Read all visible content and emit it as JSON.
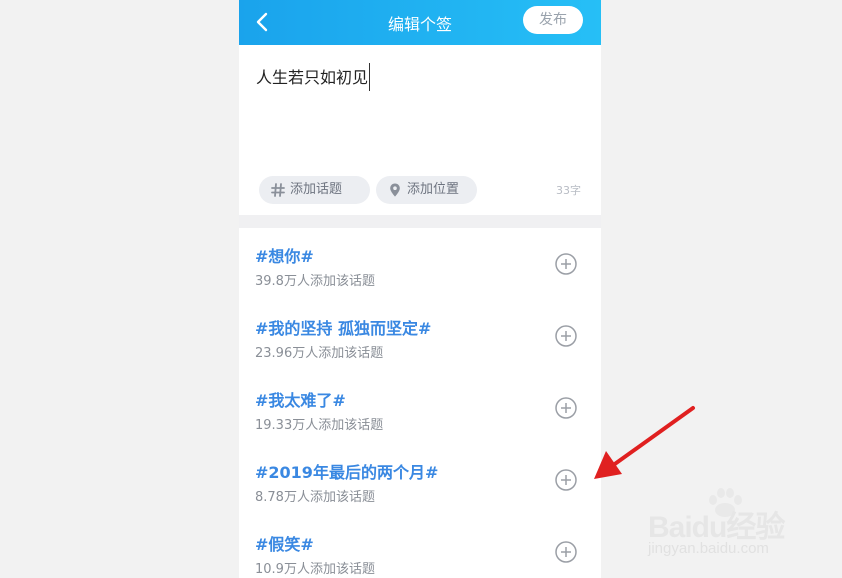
{
  "header": {
    "title": "编辑个签",
    "publish_label": "发布",
    "back_icon": "chevron-left-icon"
  },
  "editor": {
    "text": "人生若只如初见",
    "add_topic_label": "添加话题",
    "add_location_label": "添加位置",
    "char_count": "33字"
  },
  "topics": [
    {
      "title": "#想你#",
      "subtitle": "39.8万人添加该话题"
    },
    {
      "title": "#我的坚持 孤独而坚定#",
      "subtitle": "23.96万人添加该话题"
    },
    {
      "title": "#我太难了#",
      "subtitle": "19.33万人添加该话题"
    },
    {
      "title": "#2019年最后的两个月#",
      "subtitle": "8.78万人添加该话题"
    },
    {
      "title": "#假笑#",
      "subtitle": "10.9万人添加该话题"
    }
  ],
  "watermark": {
    "brand": "Baidu经验",
    "site": "jingyan.baidu.com"
  },
  "colors": {
    "header": "#1aa3ec",
    "topic": "#3a88e2",
    "annotation_arrow": "#e02020"
  }
}
